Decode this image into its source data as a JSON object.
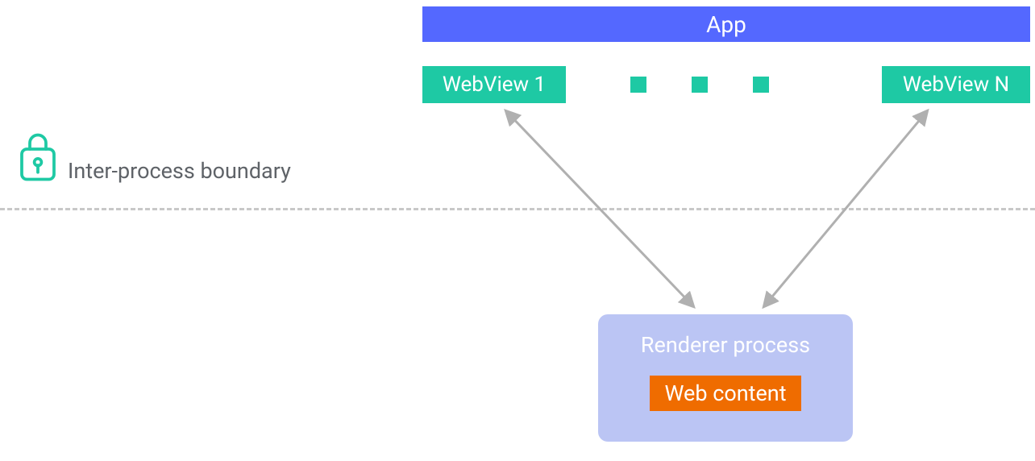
{
  "colors": {
    "blue": "#5468ff",
    "teal": "#1ec9a4",
    "orange": "#ef6c00",
    "lavender": "#bbc5f4",
    "gray_text": "#5f6368",
    "dash": "#c8c8c8",
    "arrow": "#b0b0b0"
  },
  "app_label": "App",
  "webview1_label": "WebView 1",
  "webviewn_label": "WebView N",
  "boundary_label": "Inter-process boundary",
  "renderer_label": "Renderer process",
  "webcontent_label": "Web content"
}
